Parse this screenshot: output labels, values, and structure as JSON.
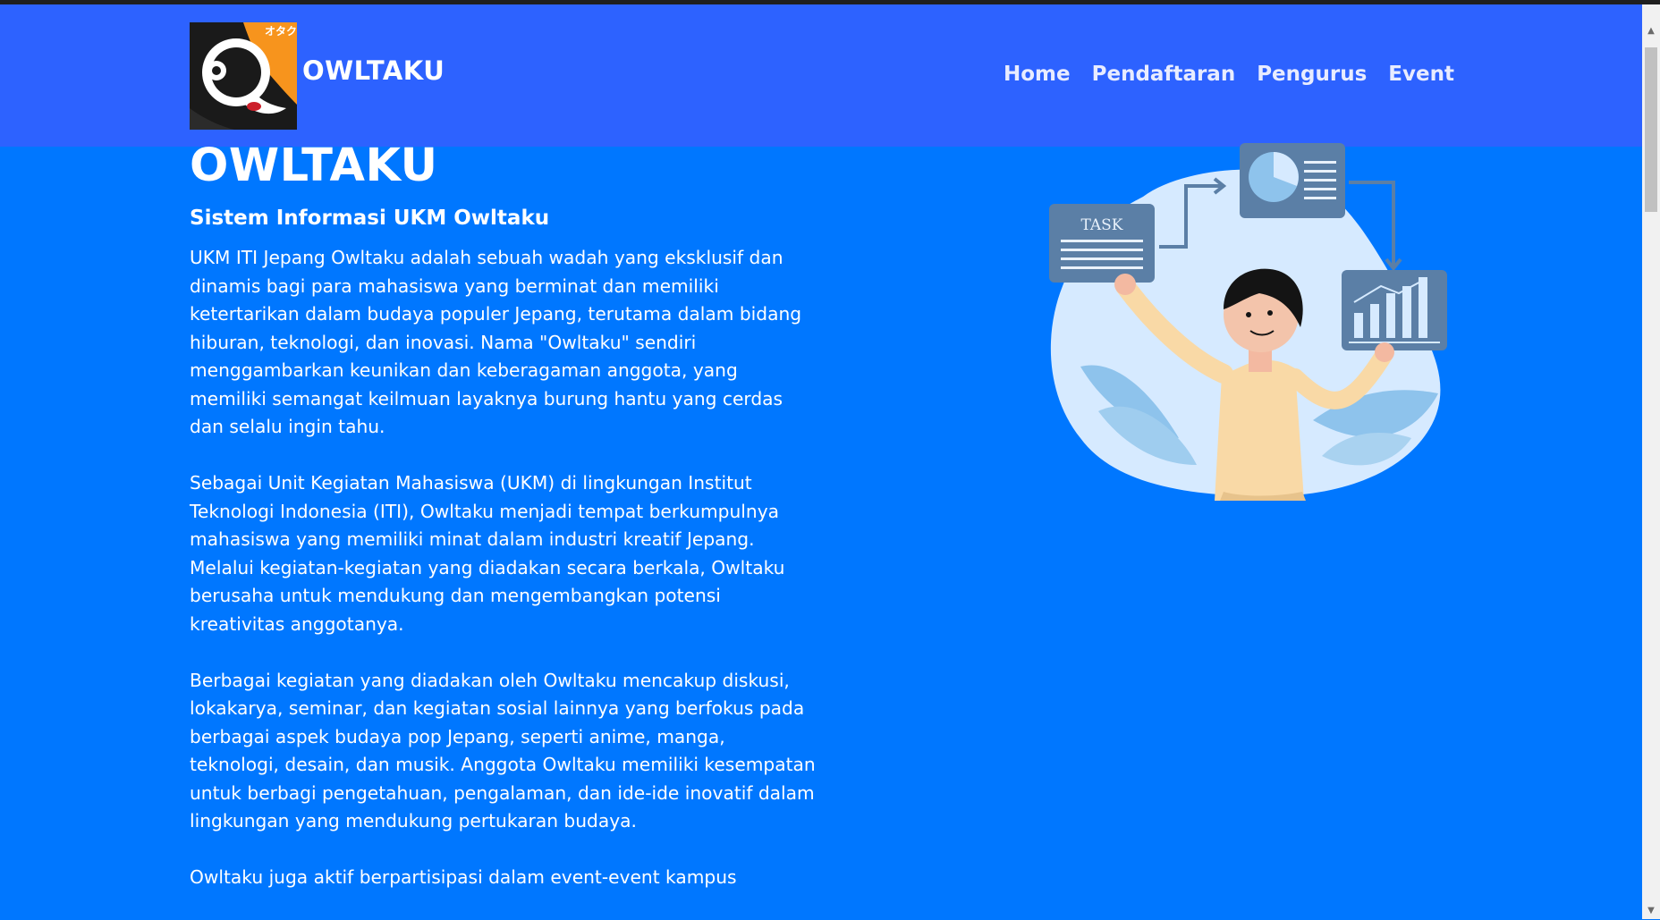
{
  "header": {
    "brand": "OWLTAKU",
    "logo_text": "オタク",
    "nav": [
      {
        "label": "Home"
      },
      {
        "label": "Pendaftaran"
      },
      {
        "label": "Pengurus"
      },
      {
        "label": "Event"
      }
    ]
  },
  "hero": {
    "title": "OWLTAKU",
    "subtitle": "Sistem Informasi UKM Owltaku",
    "paragraphs": [
      "UKM ITI Jepang Owltaku adalah sebuah wadah yang eksklusif dan dinamis bagi para mahasiswa yang berminat dan memiliki ketertarikan dalam budaya populer Jepang, terutama dalam bidang hiburan, teknologi, dan inovasi. Nama \"Owltaku\" sendiri menggambarkan keunikan dan keberagaman anggota, yang memiliki semangat keilmuan layaknya burung hantu yang cerdas dan selalu ingin tahu.",
      "Sebagai Unit Kegiatan Mahasiswa (UKM) di lingkungan Institut Teknologi Indonesia (ITI), Owltaku menjadi tempat berkumpulnya mahasiswa yang memiliki minat dalam industri kreatif Jepang. Melalui kegiatan-kegiatan yang diadakan secara berkala, Owltaku berusaha untuk mendukung dan mengembangkan potensi kreativitas anggotanya.",
      "Berbagai kegiatan yang diadakan oleh Owltaku mencakup diskusi, lokakarya, seminar, dan kegiatan sosial lainnya yang berfokus pada berbagai aspek budaya pop Jepang, seperti anime, manga, teknologi, desain, dan musik. Anggota Owltaku memiliki kesempatan untuk berbagi pengetahuan, pengalaman, dan ide-ide inovatif dalam lingkungan yang mendukung pertukaran budaya.",
      "Owltaku juga aktif berpartisipasi dalam event-event kampus"
    ]
  },
  "illustration": {
    "task_label": "TASK"
  },
  "colors": {
    "page_bg": "#0077ff",
    "navbar_bg": "#2d62ff",
    "logo_orange": "#f7941d",
    "card_bg": "#5b7fa6"
  }
}
